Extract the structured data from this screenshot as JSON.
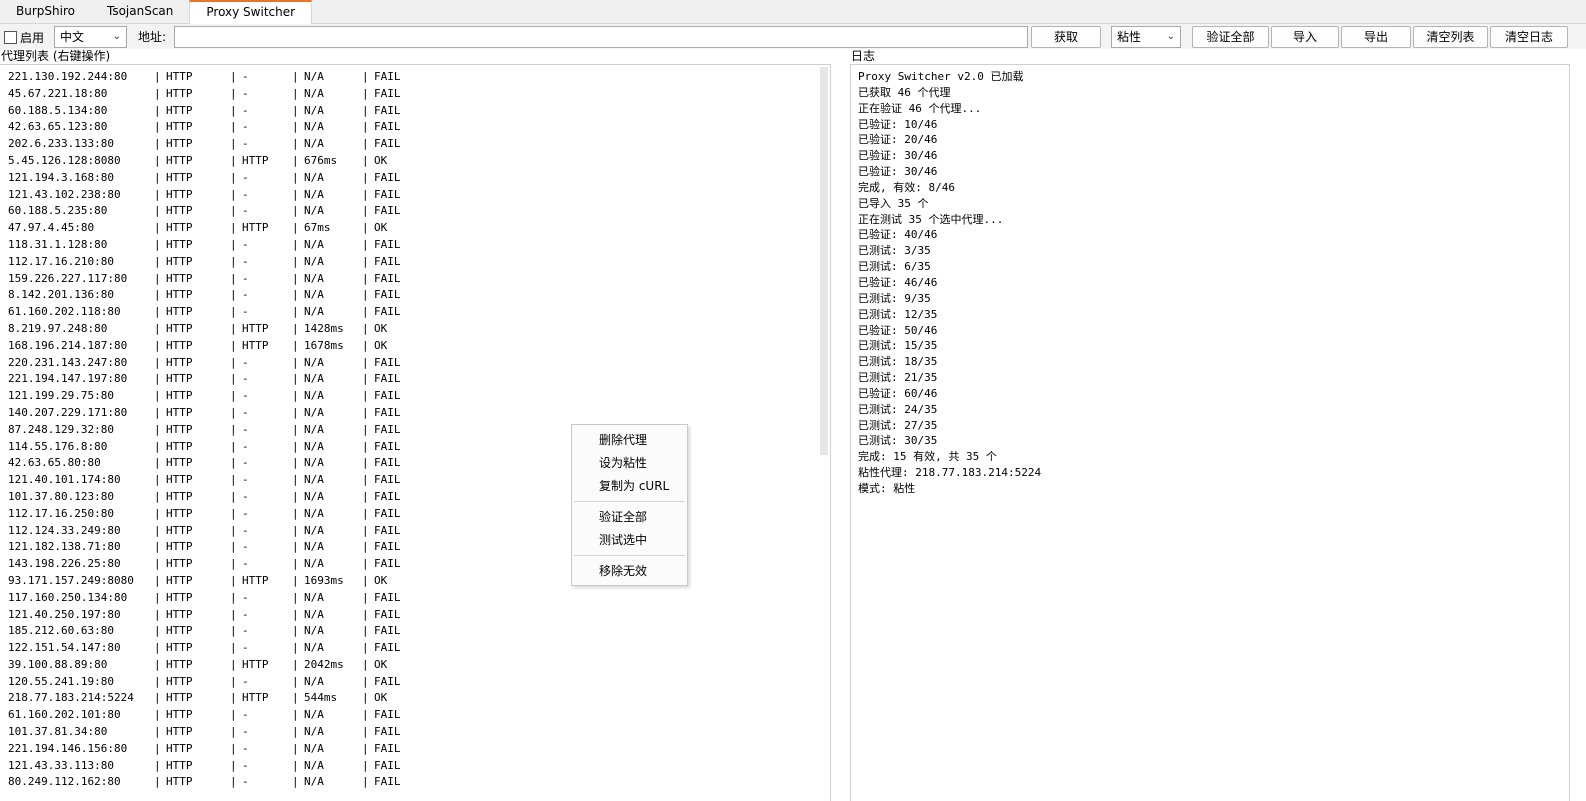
{
  "tabs": [
    {
      "label": "BurpShiro"
    },
    {
      "label": "TsojanScan"
    },
    {
      "label": "Proxy Switcher"
    }
  ],
  "toolbar": {
    "enable_label": "启用",
    "language_value": "中文",
    "address_label": "地址:",
    "address_value": "",
    "fetch_label": "获取",
    "mode_value": "粘性",
    "verify_all_label": "验证全部",
    "import_label": "导入",
    "export_label": "导出",
    "clear_list_label": "清空列表",
    "clear_log_label": "清空日志"
  },
  "proxy_title": "代理列表 (右键操作)",
  "log_title": "日志",
  "proxies": [
    {
      "ip": "221.130.192.244:80",
      "proto": "HTTP",
      "result": "-",
      "latency": "N/A",
      "status": "FAIL"
    },
    {
      "ip": "45.67.221.18:80",
      "proto": "HTTP",
      "result": "-",
      "latency": "N/A",
      "status": "FAIL"
    },
    {
      "ip": "60.188.5.134:80",
      "proto": "HTTP",
      "result": "-",
      "latency": "N/A",
      "status": "FAIL"
    },
    {
      "ip": "42.63.65.123:80",
      "proto": "HTTP",
      "result": "-",
      "latency": "N/A",
      "status": "FAIL"
    },
    {
      "ip": "202.6.233.133:80",
      "proto": "HTTP",
      "result": "-",
      "latency": "N/A",
      "status": "FAIL"
    },
    {
      "ip": "5.45.126.128:8080",
      "proto": "HTTP",
      "result": "HTTP",
      "latency": "676ms",
      "status": "OK"
    },
    {
      "ip": "121.194.3.168:80",
      "proto": "HTTP",
      "result": "-",
      "latency": "N/A",
      "status": "FAIL"
    },
    {
      "ip": "121.43.102.238:80",
      "proto": "HTTP",
      "result": "-",
      "latency": "N/A",
      "status": "FAIL"
    },
    {
      "ip": "60.188.5.235:80",
      "proto": "HTTP",
      "result": "-",
      "latency": "N/A",
      "status": "FAIL"
    },
    {
      "ip": "47.97.4.45:80",
      "proto": "HTTP",
      "result": "HTTP",
      "latency": "67ms",
      "status": "OK"
    },
    {
      "ip": "118.31.1.128:80",
      "proto": "HTTP",
      "result": "-",
      "latency": "N/A",
      "status": "FAIL"
    },
    {
      "ip": "112.17.16.210:80",
      "proto": "HTTP",
      "result": "-",
      "latency": "N/A",
      "status": "FAIL"
    },
    {
      "ip": "159.226.227.117:80",
      "proto": "HTTP",
      "result": "-",
      "latency": "N/A",
      "status": "FAIL"
    },
    {
      "ip": "8.142.201.136:80",
      "proto": "HTTP",
      "result": "-",
      "latency": "N/A",
      "status": "FAIL"
    },
    {
      "ip": "61.160.202.118:80",
      "proto": "HTTP",
      "result": "-",
      "latency": "N/A",
      "status": "FAIL"
    },
    {
      "ip": "8.219.97.248:80",
      "proto": "HTTP",
      "result": "HTTP",
      "latency": "1428ms",
      "status": "OK"
    },
    {
      "ip": "168.196.214.187:80",
      "proto": "HTTP",
      "result": "HTTP",
      "latency": "1678ms",
      "status": "OK"
    },
    {
      "ip": "220.231.143.247:80",
      "proto": "HTTP",
      "result": "-",
      "latency": "N/A",
      "status": "FAIL"
    },
    {
      "ip": "221.194.147.197:80",
      "proto": "HTTP",
      "result": "-",
      "latency": "N/A",
      "status": "FAIL"
    },
    {
      "ip": "121.199.29.75:80",
      "proto": "HTTP",
      "result": "-",
      "latency": "N/A",
      "status": "FAIL"
    },
    {
      "ip": "140.207.229.171:80",
      "proto": "HTTP",
      "result": "-",
      "latency": "N/A",
      "status": "FAIL"
    },
    {
      "ip": "87.248.129.32:80",
      "proto": "HTTP",
      "result": "-",
      "latency": "N/A",
      "status": "FAIL"
    },
    {
      "ip": "114.55.176.8:80",
      "proto": "HTTP",
      "result": "-",
      "latency": "N/A",
      "status": "FAIL"
    },
    {
      "ip": "42.63.65.80:80",
      "proto": "HTTP",
      "result": "-",
      "latency": "N/A",
      "status": "FAIL"
    },
    {
      "ip": "121.40.101.174:80",
      "proto": "HTTP",
      "result": "-",
      "latency": "N/A",
      "status": "FAIL"
    },
    {
      "ip": "101.37.80.123:80",
      "proto": "HTTP",
      "result": "-",
      "latency": "N/A",
      "status": "FAIL"
    },
    {
      "ip": "112.17.16.250:80",
      "proto": "HTTP",
      "result": "-",
      "latency": "N/A",
      "status": "FAIL"
    },
    {
      "ip": "112.124.33.249:80",
      "proto": "HTTP",
      "result": "-",
      "latency": "N/A",
      "status": "FAIL"
    },
    {
      "ip": "121.182.138.71:80",
      "proto": "HTTP",
      "result": "-",
      "latency": "N/A",
      "status": "FAIL"
    },
    {
      "ip": "143.198.226.25:80",
      "proto": "HTTP",
      "result": "-",
      "latency": "N/A",
      "status": "FAIL"
    },
    {
      "ip": "93.171.157.249:8080",
      "proto": "HTTP",
      "result": "HTTP",
      "latency": "1693ms",
      "status": "OK"
    },
    {
      "ip": "117.160.250.134:80",
      "proto": "HTTP",
      "result": "-",
      "latency": "N/A",
      "status": "FAIL"
    },
    {
      "ip": "121.40.250.197:80",
      "proto": "HTTP",
      "result": "-",
      "latency": "N/A",
      "status": "FAIL"
    },
    {
      "ip": "185.212.60.63:80",
      "proto": "HTTP",
      "result": "-",
      "latency": "N/A",
      "status": "FAIL"
    },
    {
      "ip": "122.151.54.147:80",
      "proto": "HTTP",
      "result": "-",
      "latency": "N/A",
      "status": "FAIL"
    },
    {
      "ip": "39.100.88.89:80",
      "proto": "HTTP",
      "result": "HTTP",
      "latency": "2042ms",
      "status": "OK"
    },
    {
      "ip": "120.55.241.19:80",
      "proto": "HTTP",
      "result": "-",
      "latency": "N/A",
      "status": "FAIL"
    },
    {
      "ip": "218.77.183.214:5224",
      "proto": "HTTP",
      "result": "HTTP",
      "latency": "544ms",
      "status": "OK"
    },
    {
      "ip": "61.160.202.101:80",
      "proto": "HTTP",
      "result": "-",
      "latency": "N/A",
      "status": "FAIL"
    },
    {
      "ip": "101.37.81.34:80",
      "proto": "HTTP",
      "result": "-",
      "latency": "N/A",
      "status": "FAIL"
    },
    {
      "ip": "221.194.146.156:80",
      "proto": "HTTP",
      "result": "-",
      "latency": "N/A",
      "status": "FAIL"
    },
    {
      "ip": "121.43.33.113:80",
      "proto": "HTTP",
      "result": "-",
      "latency": "N/A",
      "status": "FAIL"
    },
    {
      "ip": "80.249.112.162:80",
      "proto": "HTTP",
      "result": "-",
      "latency": "N/A",
      "status": "FAIL"
    }
  ],
  "log_lines": [
    "Proxy Switcher v2.0 已加载",
    "已获取 46 个代理",
    "正在验证 46 个代理...",
    "已验证: 10/46",
    "已验证: 20/46",
    "已验证: 30/46",
    "已验证: 30/46",
    "完成, 有效: 8/46",
    "已导入 35 个",
    "正在测试 35 个选中代理...",
    "已验证: 40/46",
    "已测试: 3/35",
    "已测试: 6/35",
    "已验证: 46/46",
    "已测试: 9/35",
    "已测试: 12/35",
    "已验证: 50/46",
    "已测试: 15/35",
    "已测试: 18/35",
    "已测试: 21/35",
    "已验证: 60/46",
    "已测试: 24/35",
    "已测试: 27/35",
    "已测试: 30/35",
    "完成: 15 有效, 共 35 个",
    "粘性代理: 218.77.183.214:5224",
    "模式: 粘性"
  ],
  "context_menu": {
    "delete": "删除代理",
    "set_sticky": "设为粘性",
    "copy_curl": "复制为 cURL",
    "verify_all": "验证全部",
    "test_selected": "测试选中",
    "remove_invalid": "移除无效"
  },
  "colors": {
    "active_tab_accent": "#e8742c"
  }
}
